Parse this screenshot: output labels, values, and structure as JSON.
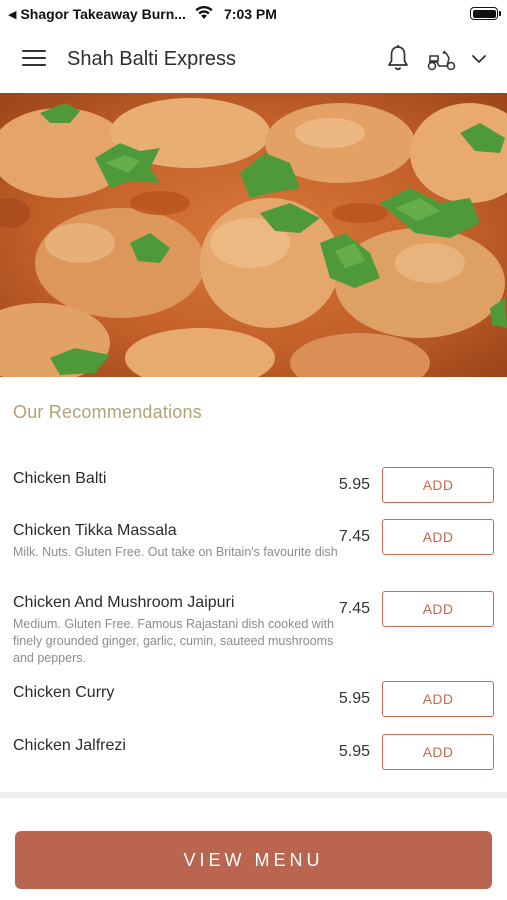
{
  "status_bar": {
    "back_app": "Shagor Takeaway Burn...",
    "time": "7:03 PM"
  },
  "header": {
    "title": "Shah Balti Express",
    "icons": [
      "menu-icon",
      "bell-icon",
      "scooter-icon",
      "chevron-down-icon"
    ]
  },
  "hero": {
    "icon": "curry-food-photo"
  },
  "recommendations": {
    "title": "Our Recommendations",
    "items": [
      {
        "name": "Chicken Balti",
        "description": "",
        "price": "5.95",
        "button": "ADD"
      },
      {
        "name": "Chicken Tikka Massala",
        "description": "Milk. Nuts. Gluten Free. Out take on Britain's favourite dish",
        "price": "7.45",
        "button": "ADD"
      },
      {
        "name": "Chicken And Mushroom Jaipuri",
        "description": "Medium. Gluten Free. Famous Rajastani dish cooked with finely grounded ginger, garlic, cumin, sauteed mushrooms and peppers.",
        "price": "7.45",
        "button": "ADD"
      },
      {
        "name": "Chicken Curry",
        "description": "",
        "price": "5.95",
        "button": "ADD"
      },
      {
        "name": "Chicken Jalfrezi",
        "description": "",
        "price": "5.95",
        "button": "ADD"
      }
    ]
  },
  "footer": {
    "view_menu_label": "VIEW MENU"
  },
  "colors": {
    "accent": "#b9654f",
    "section_title": "#b1a277",
    "add_border": "#c56b55"
  }
}
